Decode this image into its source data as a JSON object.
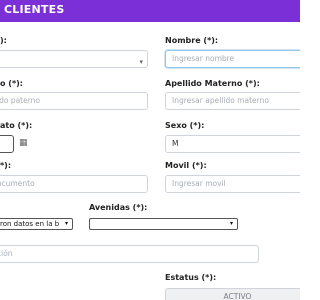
{
  "header": {
    "title": "CLIENTES"
  },
  "fields": {
    "codigo_label": "):",
    "nombre_label": "Nombre (*):",
    "nombre_placeholder": "Ingresar nombre",
    "apellido_paterno_label": "o (*):",
    "apellido_paterno_placeholder": "ido paterno",
    "apellido_materno_label": "Apellido Materno (*):",
    "apellido_materno_placeholder": "Ingresar apellido materno",
    "fecha_label": "ato (*):",
    "sexo_label": "Sexo (*):",
    "sexo_value": "M",
    "documento_label": "*):",
    "documento_placeholder": "ocumento",
    "movil_label": "Movil (*):",
    "movil_placeholder": "Ingresar movil",
    "zona_select_value": "ron datos en la b",
    "avenidas_label": "Avenidas (*):",
    "avenidas_select_value": "",
    "direccion_placeholder": "ción",
    "estatus_label": "Estatus (*):",
    "estatus_value": "ACTIVO"
  },
  "icons": {
    "select_arrow": "chevron-down-icon",
    "calendar": "calendar-icon"
  },
  "colors": {
    "header_bg": "#7b2fd6",
    "header_text": "#ffffff",
    "focus_border": "#92c5ea"
  }
}
